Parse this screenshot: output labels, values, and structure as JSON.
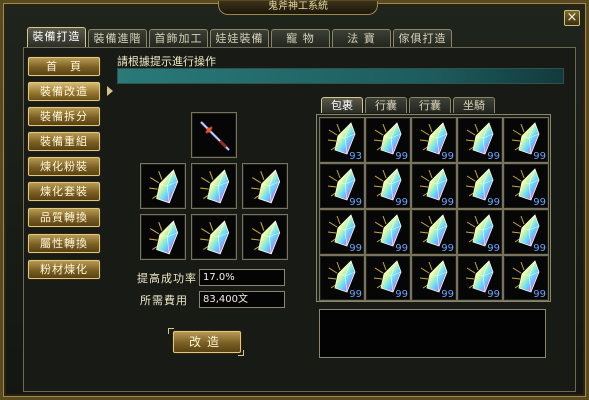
{
  "window": {
    "title": "鬼斧神工系統",
    "close_label": "×"
  },
  "top_tabs": [
    {
      "label": "裝備打造",
      "active": true
    },
    {
      "label": "裝備進階",
      "active": false
    },
    {
      "label": "首飾加工",
      "active": false
    },
    {
      "label": "娃娃裝備",
      "active": false
    },
    {
      "label": "寵 物",
      "active": false
    },
    {
      "label": "法 寶",
      "active": false
    },
    {
      "label": "傢俱打造",
      "active": false
    }
  ],
  "sidebar": {
    "items": [
      {
        "label": "首　頁"
      },
      {
        "label": "裝備改造"
      },
      {
        "label": "裝備拆分"
      },
      {
        "label": "裝備重組"
      },
      {
        "label": "煉化粉裝"
      },
      {
        "label": "煉化套裝"
      },
      {
        "label": "品質轉換"
      },
      {
        "label": "屬性轉換"
      },
      {
        "label": "粉材煉化"
      }
    ],
    "active_index": 1
  },
  "instruction": "請根據提示進行操作",
  "progress": 1.0,
  "fields": {
    "success_rate_label": "提高成功率",
    "success_rate_value": "17.0%",
    "cost_label": "所需費用",
    "cost_value": "83,400文"
  },
  "modify_button": "改造",
  "inventory": {
    "tabs": [
      {
        "label": "包裹",
        "active": true
      },
      {
        "label": "行囊",
        "active": false
      },
      {
        "label": "行囊",
        "active": false
      },
      {
        "label": "坐騎",
        "active": false
      }
    ],
    "quantities": [
      "93",
      "99",
      "99",
      "99",
      "99",
      "99",
      "99",
      "99",
      "99",
      "99",
      "99",
      "99",
      "99",
      "99",
      "99",
      "99",
      "99",
      "99",
      "99",
      "99"
    ]
  }
}
